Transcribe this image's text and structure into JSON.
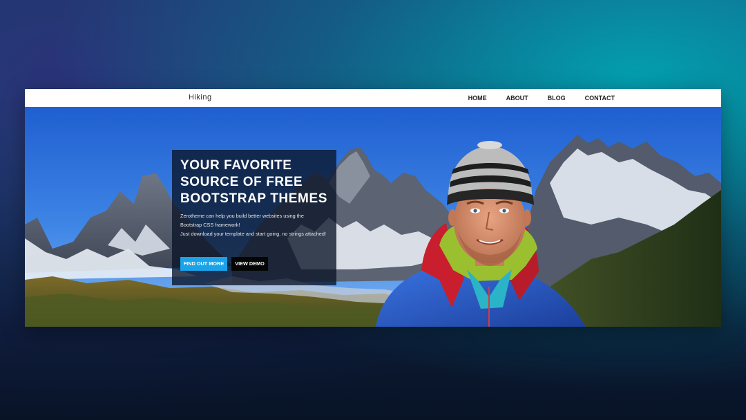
{
  "navbar": {
    "brand": "Hiking",
    "links": [
      "HOME",
      "ABOUT",
      "BLOG",
      "CONTACT"
    ]
  },
  "hero": {
    "headline_lines": [
      "YOUR FAVORITE",
      "SOURCE OF FREE",
      "BOOTSTRAP THEMES"
    ],
    "description_lines": [
      "Zerotheme can help you build better websites using the",
      "Bootstrap CSS framework!",
      "Just download your template and start going, no strings attached!"
    ],
    "primary_button": "FIND OUT MORE",
    "secondary_button": "VIEW DEMO"
  },
  "colors": {
    "primary_button": "#1aa3e8",
    "secondary_button": "#050505",
    "caption_background": "#0a1428",
    "sky": "#2f72d8",
    "jacket": "#2a5fd0"
  },
  "icons": {
    "hero_image": "hiker-portrait-mountains"
  }
}
